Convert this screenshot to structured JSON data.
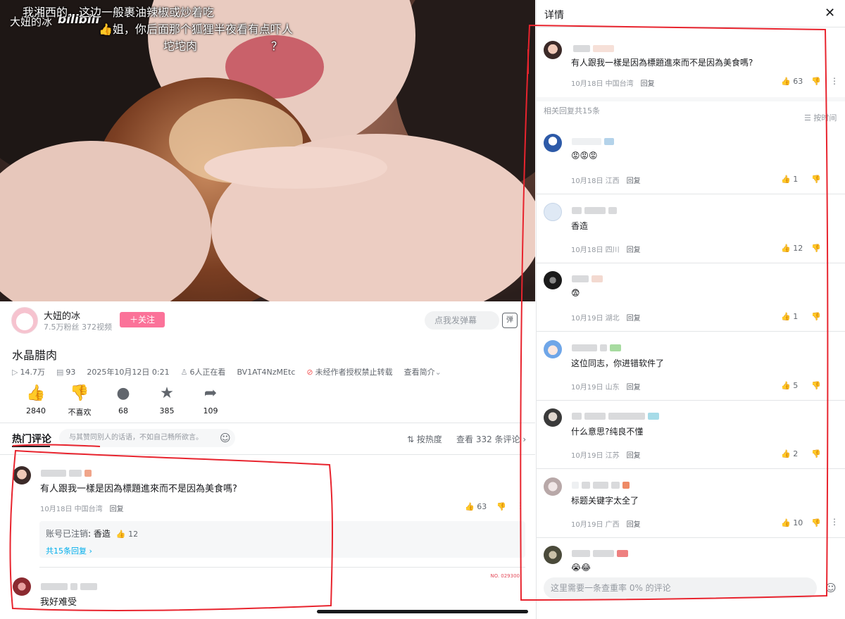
{
  "video": {
    "watermark": "大妞的冰",
    "logo": "bilibili",
    "subtitles": [
      "我湘西的，这边一般裹油辣椒或炒着吃",
      "姐，你后面那个狐狸半夜看有点吓人",
      "坨坨肉",
      "？"
    ]
  },
  "uploader": {
    "name": "大妞的冰",
    "stats": "7.5万粉丝 372视频",
    "follow_label": "＋关注"
  },
  "danmaku": {
    "placeholder": "点我发弹幕"
  },
  "title": "水晶腊肉",
  "meta": {
    "views": "14.7万",
    "danmaku_count": "93",
    "datetime": "2025年10月12日 0:21",
    "watching": "6人正在看",
    "bvid": "BV1AT4NzMEtc",
    "copyright": "未经作者授权禁止转载",
    "intro": "查看简介"
  },
  "actions": [
    {
      "label": "2840",
      "icon": "thumb-up-icon"
    },
    {
      "label": "不喜欢",
      "icon": "thumb-down-icon"
    },
    {
      "label": "68",
      "icon": "coin-icon"
    },
    {
      "label": "385",
      "icon": "star-icon"
    },
    {
      "label": "109",
      "icon": "share-icon"
    }
  ],
  "comments_header": {
    "title": "热门评论",
    "placeholder": "与其赞同别人的话语，不如自己畅所欲言。",
    "sort": "按热度",
    "view_all": "查看 332 条评论"
  },
  "comments": [
    {
      "text": "有人跟我一樣是因為標題進來而不是因為美食嗎?",
      "date": "10月18日",
      "location": "中国台湾",
      "reply": "回复",
      "likes": "63",
      "sub_reply": {
        "user": "账号已注销",
        "text": "香造",
        "likes": "12"
      },
      "reply_count": "共15条回复"
    },
    {
      "text": "我好难受"
    }
  ],
  "badge_text": "NO. 029300",
  "detail_panel": {
    "title": "详情",
    "root": {
      "text": "有人跟我一樣是因為標題進來而不是因為美食嗎?",
      "date": "10月18日",
      "location": "中国台湾",
      "reply": "回复",
      "likes": "63"
    },
    "related": "相关回复共15条",
    "sort": "按时间",
    "replies": [
      {
        "text": "😡😡😡",
        "date": "10月18日",
        "location": "江西",
        "reply": "回复",
        "likes": "1"
      },
      {
        "text": "香造",
        "date": "10月18日",
        "location": "四川",
        "reply": "回复",
        "likes": "12"
      },
      {
        "text": "😨",
        "date": "10月19日",
        "location": "湖北",
        "reply": "回复",
        "likes": "1"
      },
      {
        "text": "这位同志，你进错软件了",
        "date": "10月19日",
        "location": "山东",
        "reply": "回复",
        "likes": "5"
      },
      {
        "text": "什么意思?纯良不懂",
        "date": "10月19日",
        "location": "江苏",
        "reply": "回复",
        "likes": "2"
      },
      {
        "text": "标题关键字太全了",
        "date": "10月19日",
        "location": "广西",
        "reply": "回复",
        "likes": "10"
      },
      {
        "text": "😭😂"
      }
    ],
    "input_placeholder": "这里需要一条查重率 0% 的评论"
  },
  "colors": {
    "brand_pink": "#fb7299",
    "link_blue": "#00aeec",
    "annotation_red": "#e8242e"
  }
}
